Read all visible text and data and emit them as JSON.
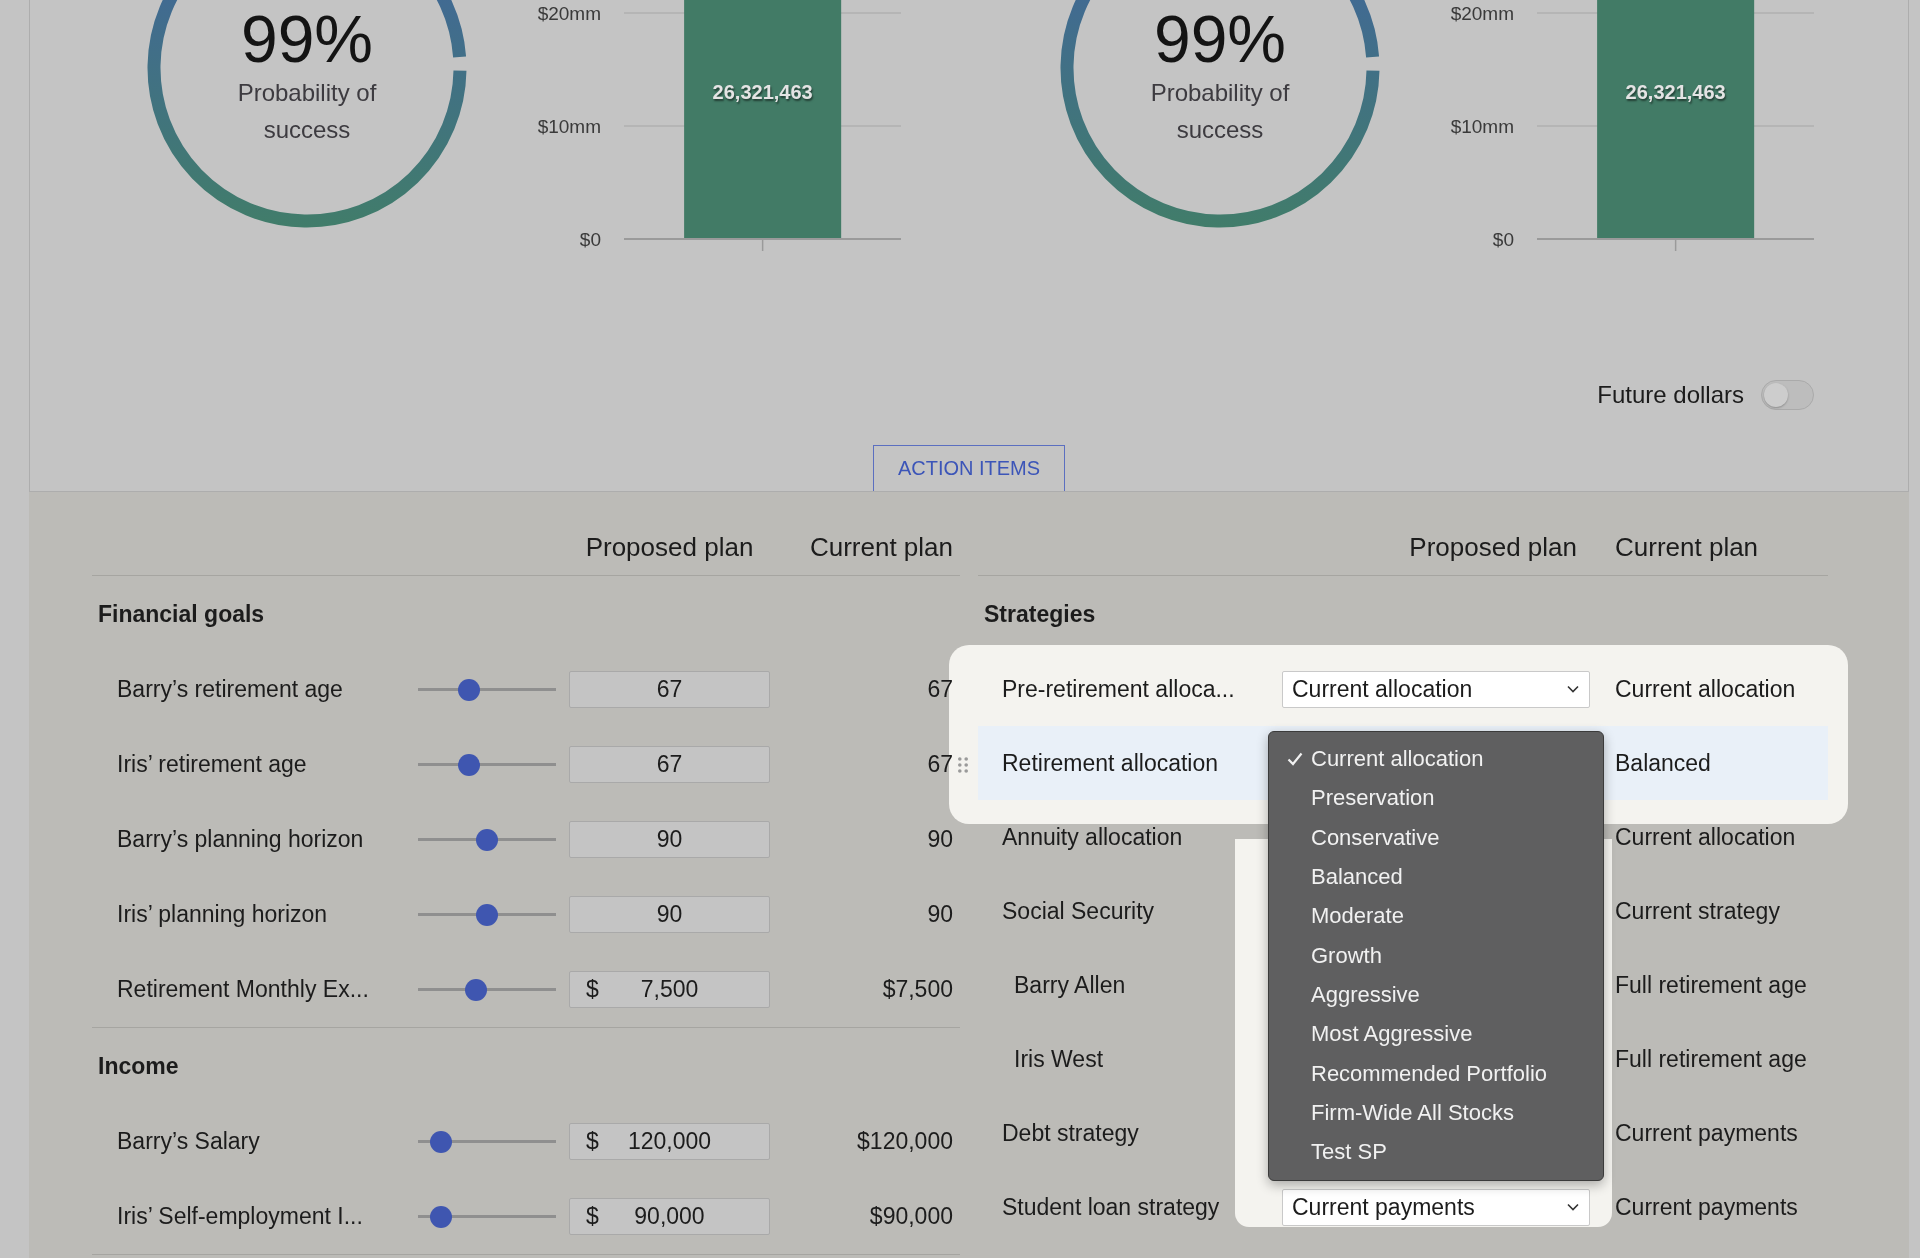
{
  "summary_panels": [
    {
      "probability": {
        "value": "99%",
        "label": "Probability of success"
      },
      "bar_chart": {
        "axis_labels": [
          "$20mm",
          "$10mm",
          "$0"
        ],
        "bar_label": "26,321,463"
      }
    },
    {
      "probability": {
        "value": "99%",
        "label": "Probability of success"
      },
      "bar_chart": {
        "axis_labels": [
          "$20mm",
          "$10mm",
          "$0"
        ],
        "bar_label": "26,321,463"
      }
    }
  ],
  "future_dollars": {
    "label": "Future dollars",
    "on": false
  },
  "action_items_button": "ACTION ITEMS",
  "left_table": {
    "columns": [
      "Proposed plan",
      "Current plan"
    ],
    "groups": [
      {
        "title": "Financial goals",
        "rows": [
          {
            "label": "Barry’s retirement age",
            "level": 0.37,
            "value": "67",
            "current": "67"
          },
          {
            "label": "Iris’ retirement age",
            "level": 0.37,
            "value": "67",
            "current": "67"
          },
          {
            "label": "Barry’s planning horizon",
            "level": 0.5,
            "value": "90",
            "current": "90"
          },
          {
            "label": "Iris’ planning horizon",
            "level": 0.5,
            "value": "90",
            "current": "90"
          },
          {
            "label": "Retirement Monthly Ex...",
            "level": 0.42,
            "prefix": "$",
            "value": "7,500",
            "current": "$7,500"
          }
        ]
      },
      {
        "title": "Income",
        "rows": [
          {
            "label": "Barry’s Salary",
            "level": 0.17,
            "prefix": "$",
            "value": "120,000",
            "current": "$120,000"
          },
          {
            "label": "Iris’ Self-employment I...",
            "level": 0.17,
            "prefix": "$",
            "value": "90,000",
            "current": "$90,000"
          }
        ]
      }
    ]
  },
  "right_table": {
    "columns": [
      "Proposed plan",
      "Current plan"
    ],
    "groups": [
      {
        "title": "Strategies",
        "rows": [
          {
            "label": "Pre-retirement alloca...",
            "spotlight": true,
            "selected": false,
            "select": "Current allocation",
            "current": "Current allocation"
          },
          {
            "label": "Retirement allocation",
            "spotlight": true,
            "selected": true,
            "current": "Balanced",
            "menu": {
              "options": [
                {
                  "label": "Current allocation",
                  "selected": true
                },
                {
                  "label": "Preservation",
                  "selected": false
                },
                {
                  "label": "Conservative",
                  "selected": false
                },
                {
                  "label": "Balanced",
                  "selected": false
                },
                {
                  "label": "Moderate",
                  "selected": false
                },
                {
                  "label": "Growth",
                  "selected": false
                },
                {
                  "label": "Aggressive",
                  "selected": false
                },
                {
                  "label": "Most Aggressive",
                  "selected": false
                },
                {
                  "label": "Recommended Portfolio",
                  "selected": false
                },
                {
                  "label": "Firm-Wide All Stocks",
                  "selected": false
                },
                {
                  "label": "Test SP",
                  "selected": false
                }
              ]
            }
          },
          {
            "label": "Annuity allocation",
            "spotlight": false,
            "selected": false,
            "current": "Current allocation"
          },
          {
            "label": "Social Security",
            "spotlight": false,
            "selected": false,
            "current": "Current strategy",
            "children": [
              {
                "label": "Barry Allen",
                "current": "Full retirement age"
              },
              {
                "label": "Iris West",
                "current": "Full retirement age"
              }
            ]
          },
          {
            "label": "Debt strategy",
            "spotlight": false,
            "selected": false,
            "current": "Current payments"
          },
          {
            "label": "Student loan strategy",
            "spotlight": false,
            "selected": false,
            "select": "Current payments",
            "current": "Current payments"
          }
        ]
      }
    ]
  }
}
